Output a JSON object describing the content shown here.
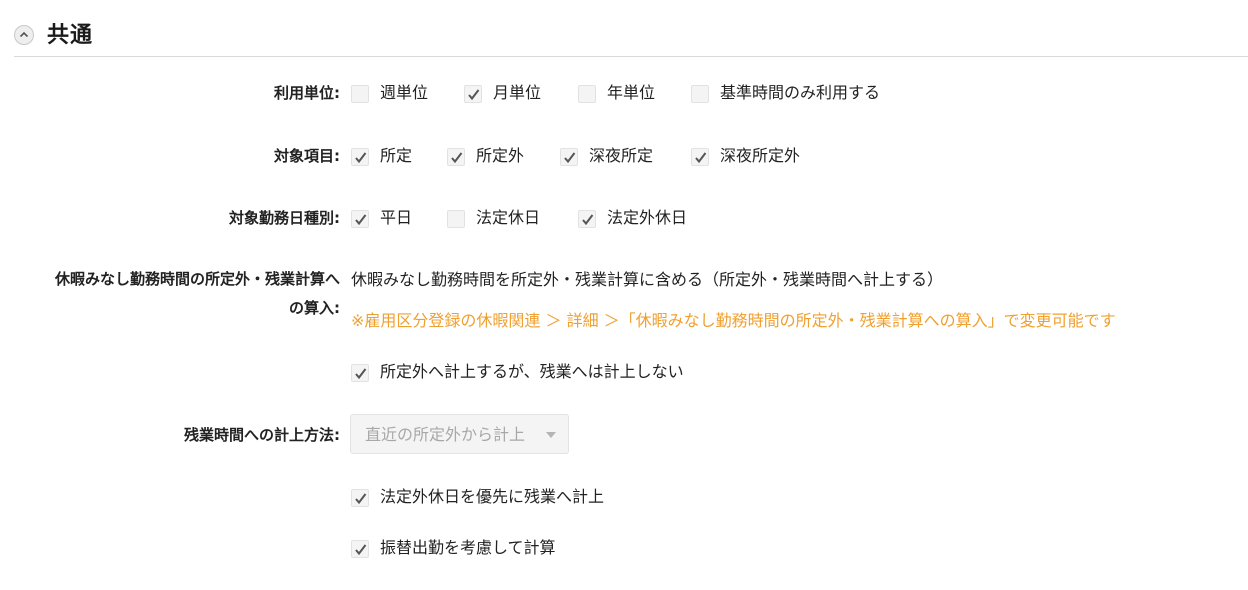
{
  "section": {
    "title": "共通"
  },
  "usage_unit": {
    "label": "利用単位:",
    "options": [
      {
        "label": "週単位",
        "checked": false
      },
      {
        "label": "月単位",
        "checked": true
      },
      {
        "label": "年単位",
        "checked": false
      },
      {
        "label": "基準時間のみ利用する",
        "checked": false
      }
    ]
  },
  "target_items": {
    "label": "対象項目:",
    "options": [
      {
        "label": "所定",
        "checked": true
      },
      {
        "label": "所定外",
        "checked": true
      },
      {
        "label": "深夜所定",
        "checked": true
      },
      {
        "label": "深夜所定外",
        "checked": true
      }
    ]
  },
  "workday_types": {
    "label": "対象勤務日種別:",
    "options": [
      {
        "label": "平日",
        "checked": true
      },
      {
        "label": "法定休日",
        "checked": false
      },
      {
        "label": "法定外休日",
        "checked": true
      }
    ]
  },
  "leave_deemed": {
    "label_line1": "休暇みなし勤務時間の所定外・残業計算へ",
    "label_line2": "の算入:",
    "value": "休暇みなし勤務時間を所定外・残業計算に含める（所定外・残業時間へ計上する）",
    "note": "※雇用区分登録の休暇関連 ＞ 詳細 ＞「休暇みなし勤務時間の所定外・残業計算への算入」で変更可能です",
    "option": {
      "label": "所定外へ計上するが、残業へは計上しない",
      "checked": true
    }
  },
  "overtime_method": {
    "label": "残業時間への計上方法:",
    "selected": "直近の所定外から計上",
    "options": [
      {
        "label": "法定外休日を優先に残業へ計上",
        "checked": true
      },
      {
        "label": "振替出勤を考慮して計算",
        "checked": true
      }
    ]
  },
  "colors": {
    "note": "#f0a030",
    "checkbox_bg": "#f4f4f4",
    "checkmark": "#555555"
  }
}
